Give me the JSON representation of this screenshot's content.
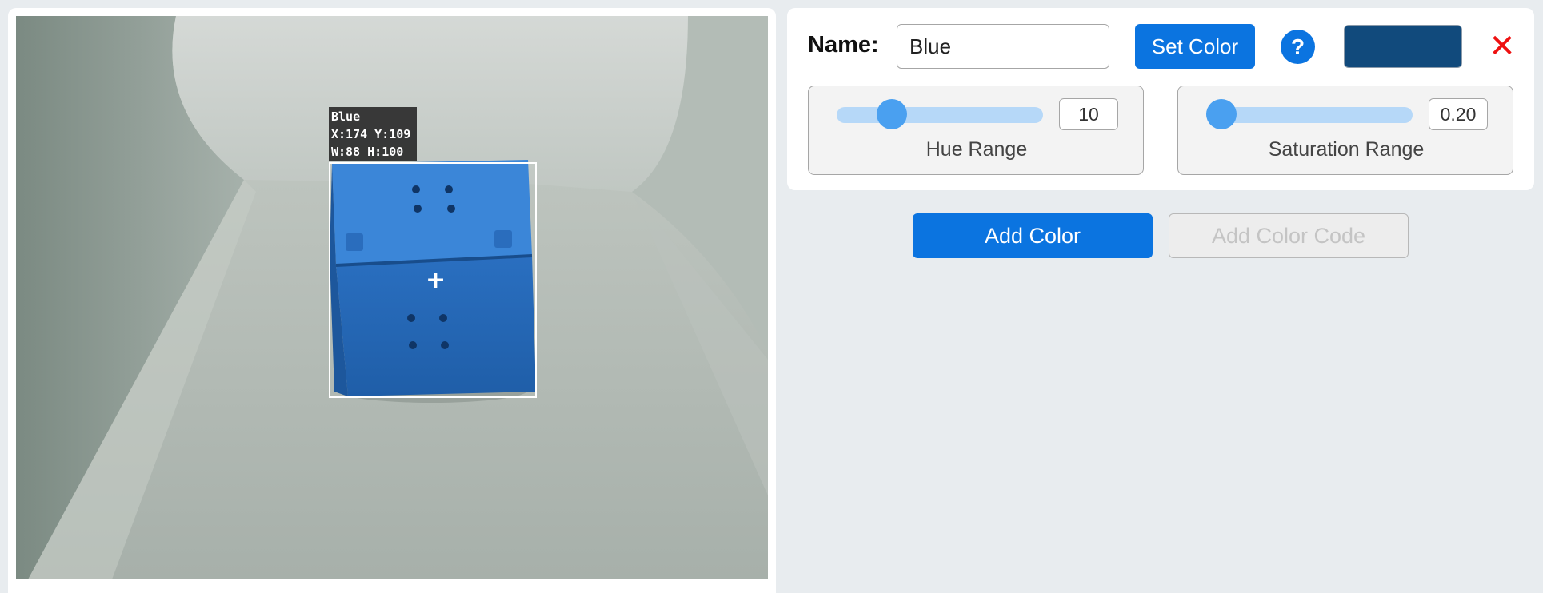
{
  "camera": {
    "detection": {
      "label_name": "Blue",
      "label_xy": "X:174 Y:109",
      "label_wh": "W:88 H:100",
      "crosshair": "+"
    }
  },
  "color_card": {
    "name_label": "Name:",
    "name_value": "Blue",
    "set_color_label": "Set Color",
    "help_label": "?",
    "swatch_color": "#114a7c",
    "close_label": "✕",
    "hue_range": {
      "label": "Hue Range",
      "value": "10"
    },
    "saturation_range": {
      "label": "Saturation Range",
      "value": "0.20"
    }
  },
  "actions": {
    "add_color_label": "Add Color",
    "add_color_code_label": "Add Color Code"
  },
  "colors": {
    "accent": "#0b74e0",
    "close": "#ee1111",
    "detected_object": "#2b7ad1"
  }
}
